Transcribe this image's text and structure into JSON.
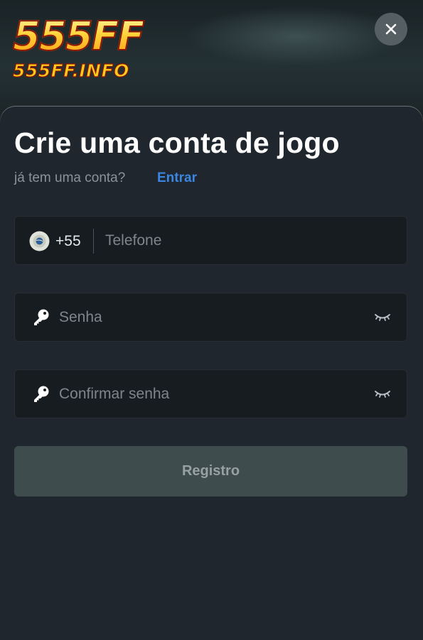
{
  "brand": {
    "logo_text": "555FF",
    "site": "555FF.INFO"
  },
  "header": {
    "close_icon": "close-icon"
  },
  "form": {
    "title": "Crie uma conta de jogo",
    "subtitle": "já tem uma conta?",
    "login_link": "Entrar",
    "phone": {
      "country_code": "+55",
      "country_icon": "brazil-flag-icon",
      "placeholder": "Telefone",
      "value": ""
    },
    "password": {
      "icon": "key-icon",
      "placeholder": "Senha",
      "value": "",
      "toggle_icon": "eye-closed-icon"
    },
    "confirm_password": {
      "icon": "key-icon",
      "placeholder": "Confirmar senha",
      "value": "",
      "toggle_icon": "eye-closed-icon"
    },
    "submit_label": "Registro"
  },
  "colors": {
    "sheet_background": "#20262e",
    "field_background": "#171c21",
    "link": "#3a86e0",
    "button_background": "#3f4c4e",
    "button_text": "#97a1a3"
  }
}
